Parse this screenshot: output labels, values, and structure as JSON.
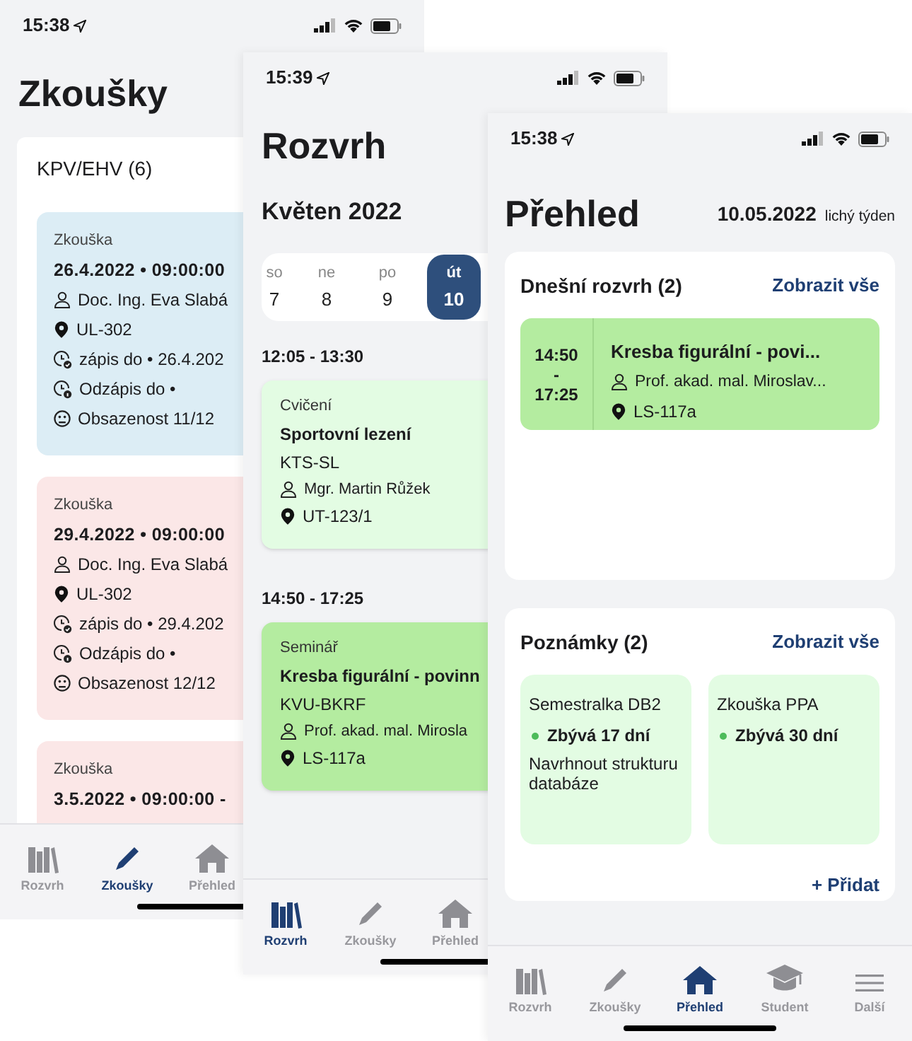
{
  "exams_screen": {
    "status_time": "15:38",
    "title": "Zkoušky",
    "group": "KPV/EHV (6)",
    "exams": [
      {
        "color": "#dcedf5",
        "type": "Zkouška",
        "datetime": "26.4.2022 • 09:00:00",
        "rows": [
          {
            "kind": "teacher",
            "text": "Doc. Ing. Eva Slabá"
          },
          {
            "kind": "room",
            "text": "UL-302"
          },
          {
            "kind": "signup",
            "text": "zápis do • 26.4.202"
          },
          {
            "kind": "signoff",
            "text": "Odzápis do •"
          },
          {
            "kind": "capacity",
            "text": "Obsazenost 11/12"
          }
        ]
      },
      {
        "color": "#fbe7e7",
        "type": "Zkouška",
        "datetime": "29.4.2022 • 09:00:00",
        "rows": [
          {
            "kind": "teacher",
            "text": "Doc. Ing. Eva Slabá"
          },
          {
            "kind": "room",
            "text": "UL-302"
          },
          {
            "kind": "signup",
            "text": "zápis do • 29.4.202"
          },
          {
            "kind": "signoff",
            "text": "Odzápis do •"
          },
          {
            "kind": "capacity",
            "text": "Obsazenost 12/12"
          }
        ]
      },
      {
        "color": "#fbe7e7",
        "type": "Zkouška",
        "datetime": "3.5.2022 • 09:00:00 -"
      }
    ],
    "tabs": [
      {
        "kind": "books",
        "label": "Rozvrh",
        "selected": false
      },
      {
        "kind": "pencil",
        "label": "Zkoušky",
        "selected": true
      },
      {
        "kind": "house",
        "label": "Přehled",
        "selected": false
      }
    ]
  },
  "schedule_screen": {
    "status_time": "15:39",
    "title": "Rozvrh",
    "month": "Květen 2022",
    "days": [
      {
        "weekday": "so",
        "day": "7",
        "selected": false
      },
      {
        "weekday": "ne",
        "day": "8",
        "selected": false
      },
      {
        "weekday": "po",
        "day": "9",
        "selected": false
      },
      {
        "weekday": "út",
        "day": "10",
        "selected": true
      }
    ],
    "lessons": [
      {
        "time": "12:05 - 13:30",
        "color": "#e3fce3",
        "type": "Cvičení",
        "title": "Sportovní lezení",
        "code": "KTS-SL",
        "teacher": "Mgr. Martin Růžek",
        "room": "UT-123/1"
      },
      {
        "time": "14:50 - 17:25",
        "color": "#b4eca0",
        "type": "Seminář",
        "title": "Kresba figurální - povinn",
        "code": "KVU-BKRF",
        "teacher": "Prof. akad. mal. Mirosla",
        "room": "LS-117a"
      }
    ],
    "tabs": [
      {
        "kind": "books",
        "label": "Rozvrh",
        "selected": true
      },
      {
        "kind": "pencil",
        "label": "Zkoušky",
        "selected": false
      },
      {
        "kind": "house",
        "label": "Přehled",
        "selected": false
      }
    ]
  },
  "overview_screen": {
    "status_time": "15:38",
    "title": "Přehled",
    "date": "10.05.2022",
    "week": "lichý týden",
    "today": {
      "heading": "Dnešní rozvrh (2)",
      "link": "Zobrazit vše",
      "lessons": [
        {
          "time": [
            "14:50",
            "-",
            "17:25"
          ],
          "title": "Kresba figurální - povi...",
          "teacher": "Prof. akad. mal. Miroslav...",
          "room": "LS-117a"
        }
      ]
    },
    "notes": {
      "heading": "Poznámky (2)",
      "link": "Zobrazit vše",
      "add": "+ Přidat",
      "items": [
        {
          "title": "Semestralka DB2",
          "remaining": "Zbývá 17 dní",
          "text": "Navrhnout strukturu databáze"
        },
        {
          "title": "Zkouška PPA",
          "remaining": "Zbývá 30 dní"
        }
      ]
    },
    "tabs": [
      {
        "kind": "books",
        "label": "Rozvrh",
        "selected": false
      },
      {
        "kind": "pencil",
        "label": "Zkoušky",
        "selected": false
      },
      {
        "kind": "house",
        "label": "Přehled",
        "selected": true
      },
      {
        "kind": "cap",
        "label": "Student",
        "selected": false
      },
      {
        "kind": "menu",
        "label": "Další",
        "selected": false
      }
    ]
  }
}
